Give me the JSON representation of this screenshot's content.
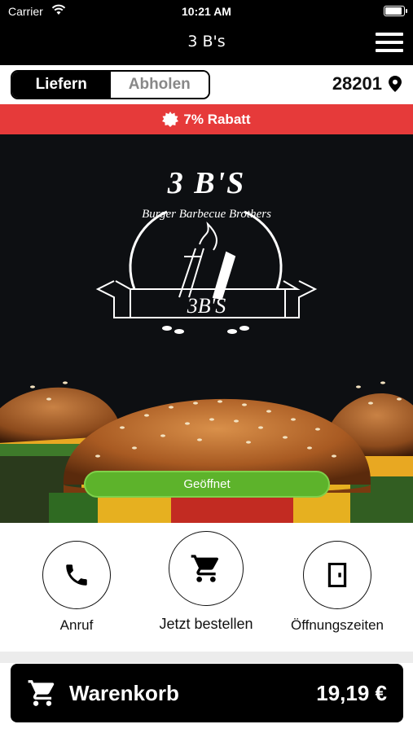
{
  "status_bar": {
    "carrier": "Carrier",
    "time": "10:21 AM"
  },
  "nav": {
    "title": "3 B's"
  },
  "order_mode": {
    "options": [
      "Liefern",
      "Abholen"
    ],
    "selected": "Liefern"
  },
  "location": {
    "zip": "28201"
  },
  "promo": {
    "text": "7% Rabatt"
  },
  "hero": {
    "brand": "3 B'S",
    "arc_text": "Burger  Barbecue  Brothers",
    "banner_text": "3B'S",
    "status_button": "Geöffnet"
  },
  "actions": [
    {
      "label": "Anruf",
      "icon": "phone-icon"
    },
    {
      "label": "Jetzt bestellen",
      "icon": "cart-icon"
    },
    {
      "label": "Öffnungszeiten",
      "icon": "door-icon"
    }
  ],
  "cart": {
    "label": "Warenkorb",
    "total": "19,19 €"
  },
  "colors": {
    "accent_red": "#e63a3a",
    "open_green": "#5db32b",
    "dark": "#000000"
  }
}
